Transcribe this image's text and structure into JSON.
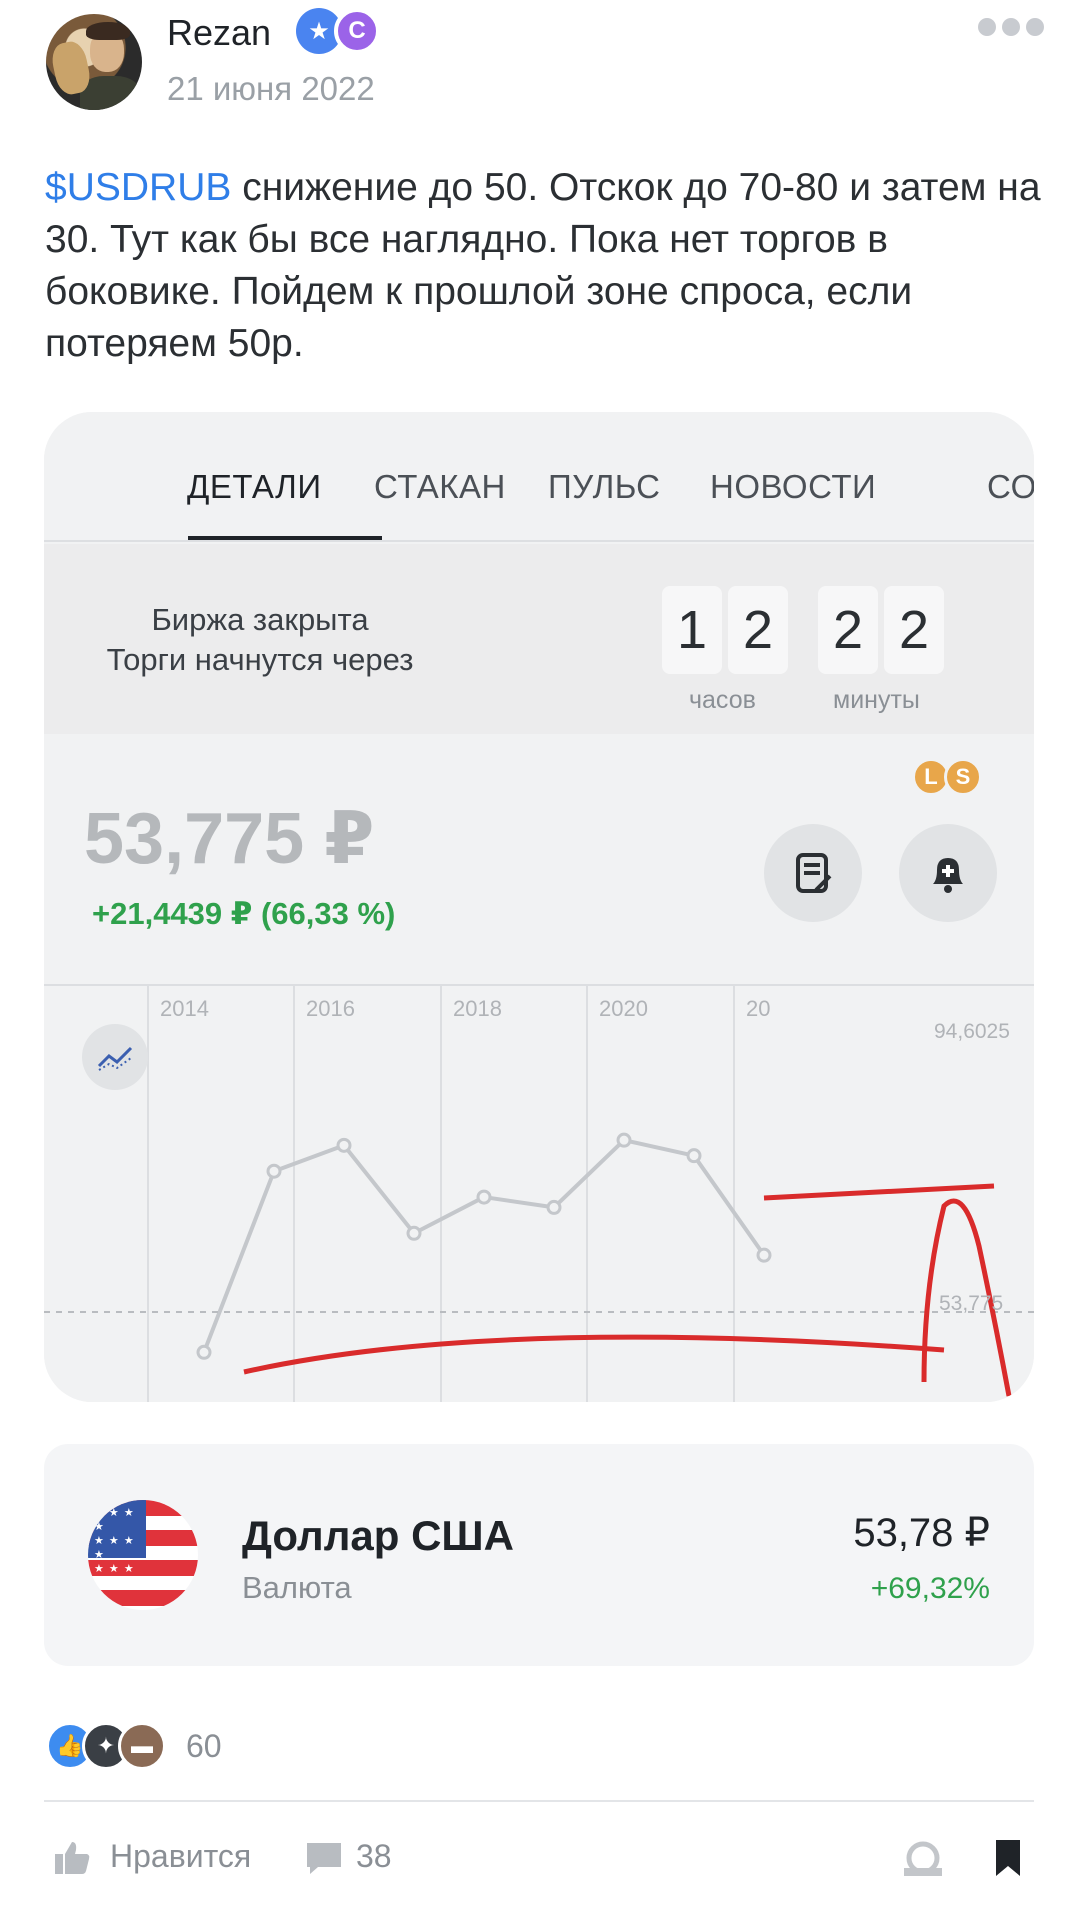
{
  "post": {
    "author": "Rezan",
    "date": "21 июня 2022",
    "ticker": "$USDRUB",
    "text": " снижение до 50. Отскок до 70-80 и затем на 30. Тут как бы все наглядно. Пока нет торгов в боковике. Пойдем к прошлой зоне спроса, если потеряем 50р."
  },
  "badges": {
    "star": "★",
    "c": "C"
  },
  "screenshot": {
    "tabs": [
      "ДЕТАЛИ",
      "СТАКАН",
      "ПУЛЬС",
      "НОВОСТИ",
      "СО"
    ],
    "market": {
      "status": "Биржа закрыта",
      "countdown_label": "Торги начнутся через",
      "hours": [
        "1",
        "2"
      ],
      "minutes": [
        "2",
        "2"
      ],
      "hours_unit": "часов",
      "minutes_unit": "минуты"
    },
    "quote": {
      "price": "53,775 ₽",
      "change": "+21,4439 ₽ (66,33 %)",
      "badge_l": "L",
      "badge_s": "S"
    },
    "chart_labels": {
      "years": [
        "2014",
        "2016",
        "2018",
        "2020",
        "20"
      ],
      "high": "94,6025",
      "current": "53,775"
    }
  },
  "chart_data": {
    "type": "line",
    "x": [
      "2014",
      "2015",
      "2016",
      "2017",
      "2018",
      "2019",
      "2020",
      "2021",
      "2022"
    ],
    "series": [
      {
        "values": [
          35,
          70,
          75,
          58,
          65,
          63,
          76,
          73,
          53.775
        ]
      }
    ],
    "annotations": [
      "94,6025",
      "53,775"
    ],
    "grid": true
  },
  "colors": {
    "accent": "#2f7ee8",
    "positive": "#2fa14c",
    "annotation": "#d92b2b"
  },
  "card": {
    "name": "Доллар США",
    "type": "Валюта",
    "price": "53,78 ₽",
    "change": "+69,32%"
  },
  "reactions": {
    "count": "60"
  },
  "actions": {
    "like_label": "Нравится",
    "comments_count": "38"
  },
  "icons": {
    "more": "more-dots-icon",
    "notes": "notes-icon",
    "alert": "bell-plus-icon",
    "indicators": "indicators-icon",
    "like": "thumb-up-icon",
    "comment": "comment-icon",
    "repost": "repost-icon",
    "bookmark": "bookmark-icon"
  }
}
